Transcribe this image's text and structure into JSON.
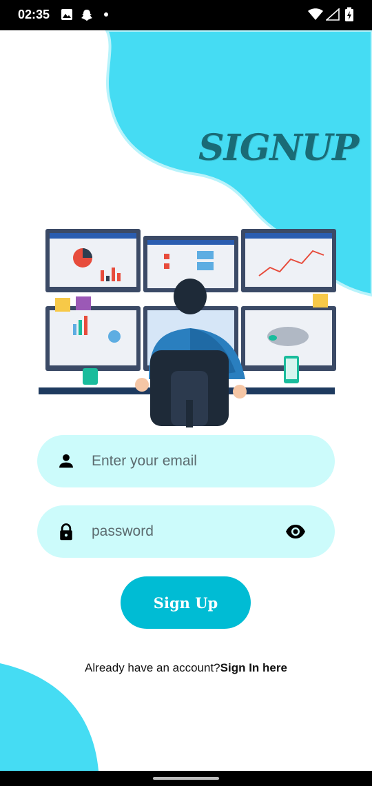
{
  "status_bar": {
    "time": "02:35"
  },
  "colors": {
    "accent": "#00bcd4",
    "blob": "#45dcf3",
    "field_bg": "#ccfbfb",
    "title": "#1a6b76"
  },
  "header": {
    "title": "SIGNUP"
  },
  "form": {
    "email_placeholder": "Enter your email",
    "email_icon": "person-icon",
    "password_placeholder": "password",
    "password_icon": "lock-icon",
    "toggle_icon": "eye-icon",
    "submit_label": "Sign Up"
  },
  "footer": {
    "prompt": "Already have an account?",
    "link": "Sign In here"
  }
}
